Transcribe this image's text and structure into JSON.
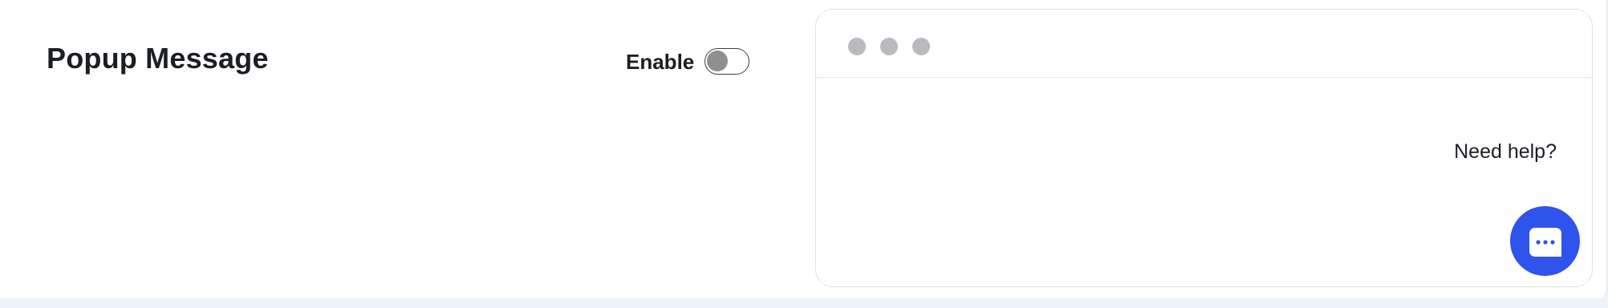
{
  "section": {
    "title": "Popup Message",
    "enable_label": "Enable",
    "enabled": false
  },
  "preview": {
    "window_dots": [
      "dot",
      "dot",
      "dot"
    ],
    "help_text": "Need help?",
    "chat_button_icon": "chat-bubble-icon",
    "accent_color": "#2f54eb"
  }
}
